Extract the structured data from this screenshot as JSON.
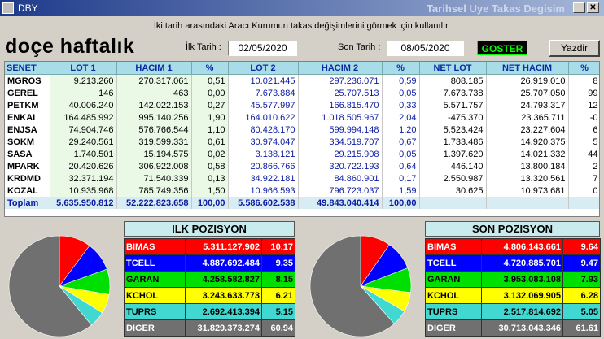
{
  "window": {
    "title": "DBY",
    "header_title": "Tarihsel Uye Takas Degisim"
  },
  "info_text": "İki tarih arasındaki Aracı Kurumun takas değişimlerini görmek için kullanılır.",
  "headline": "doçe haftalık",
  "first_date": {
    "label": "İlk Tarih :",
    "value": "02/05/2020"
  },
  "last_date": {
    "label": "Son Tarih :",
    "value": "08/05/2020"
  },
  "buttons": {
    "goster": "GOSTER",
    "yazdir": "Yazdir"
  },
  "table": {
    "headers": [
      "SENET",
      "LOT 1",
      "HACIM 1",
      "%",
      "LOT 2",
      "HACIM 2",
      "%",
      "NET LOT",
      "NET HACIM",
      "%"
    ],
    "rows": [
      [
        "MGROS",
        "9.213.260",
        "270.317.061",
        "0,51",
        "10.021.445",
        "297.236.071",
        "0,59",
        "808.185",
        "26.919.010",
        "8"
      ],
      [
        "GEREL",
        "146",
        "463",
        "0,00",
        "7.673.884",
        "25.707.513",
        "0,05",
        "7.673.738",
        "25.707.050",
        "99"
      ],
      [
        "PETKM",
        "40.006.240",
        "142.022.153",
        "0,27",
        "45.577.997",
        "166.815.470",
        "0,33",
        "5.571.757",
        "24.793.317",
        "12"
      ],
      [
        "ENKAI",
        "164.485.992",
        "995.140.256",
        "1,90",
        "164.010.622",
        "1.018.505.967",
        "2,04",
        "-475.370",
        "23.365.711",
        "-0"
      ],
      [
        "ENJSA",
        "74.904.746",
        "576.766.544",
        "1,10",
        "80.428.170",
        "599.994.148",
        "1,20",
        "5.523.424",
        "23.227.604",
        "6"
      ],
      [
        "SOKM",
        "29.240.561",
        "319.599.331",
        "0,61",
        "30.974.047",
        "334.519.707",
        "0,67",
        "1.733.486",
        "14.920.375",
        "5"
      ],
      [
        "SASA",
        "1.740.501",
        "15.194.575",
        "0,02",
        "3.138.121",
        "29.215.908",
        "0,05",
        "1.397.620",
        "14.021.332",
        "44"
      ],
      [
        "MPARK",
        "20.420.626",
        "306.922.008",
        "0,58",
        "20.866.766",
        "320.722.193",
        "0,64",
        "446.140",
        "13.800.184",
        "2"
      ],
      [
        "KRDMD",
        "32.371.194",
        "71.540.339",
        "0,13",
        "34.922.181",
        "84.860.901",
        "0,17",
        "2.550.987",
        "13.320.561",
        "7"
      ],
      [
        "KOZAL",
        "10.935.968",
        "785.749.356",
        "1,50",
        "10.966.593",
        "796.723.037",
        "1,59",
        "30.625",
        "10.973.681",
        "0"
      ]
    ],
    "total": [
      "Toplam",
      "5.635.950.812",
      "52.222.823.658",
      "100,00",
      "5.586.602.538",
      "49.843.040.414",
      "100,00",
      "",
      "",
      ""
    ]
  },
  "ilk_pozisyon": {
    "title": "ILK POZISYON",
    "rows": [
      {
        "code": "BIMAS",
        "value": "5.311.127.902",
        "pct": "10.17",
        "color": "#ff0000",
        "text": "#ffffff"
      },
      {
        "code": "TCELL",
        "value": "4.887.692.484",
        "pct": "9.35",
        "color": "#0000ff",
        "text": "#ffffff"
      },
      {
        "code": "GARAN",
        "value": "4.258.582.827",
        "pct": "8.15",
        "color": "#00e000",
        "text": "#000000"
      },
      {
        "code": "KCHOL",
        "value": "3.243.633.773",
        "pct": "6.21",
        "color": "#ffff00",
        "text": "#000000"
      },
      {
        "code": "TUPRS",
        "value": "2.692.413.394",
        "pct": "5.15",
        "color": "#40d8d0",
        "text": "#000000"
      },
      {
        "code": "DIGER",
        "value": "31.829.373.274",
        "pct": "60.94",
        "color": "#707070",
        "text": "#ffffff"
      }
    ]
  },
  "son_pozisyon": {
    "title": "SON POZISYON",
    "rows": [
      {
        "code": "BIMAS",
        "value": "4.806.143.661",
        "pct": "9.64",
        "color": "#ff0000",
        "text": "#ffffff"
      },
      {
        "code": "TCELL",
        "value": "4.720.885.701",
        "pct": "9.47",
        "color": "#0000ff",
        "text": "#ffffff"
      },
      {
        "code": "GARAN",
        "value": "3.953.083.108",
        "pct": "7.93",
        "color": "#00e000",
        "text": "#000000"
      },
      {
        "code": "KCHOL",
        "value": "3.132.069.905",
        "pct": "6.28",
        "color": "#ffff00",
        "text": "#000000"
      },
      {
        "code": "TUPRS",
        "value": "2.517.814.692",
        "pct": "5.05",
        "color": "#40d8d0",
        "text": "#000000"
      },
      {
        "code": "DIGER",
        "value": "30.713.043.346",
        "pct": "61.61",
        "color": "#707070",
        "text": "#ffffff"
      }
    ]
  }
}
